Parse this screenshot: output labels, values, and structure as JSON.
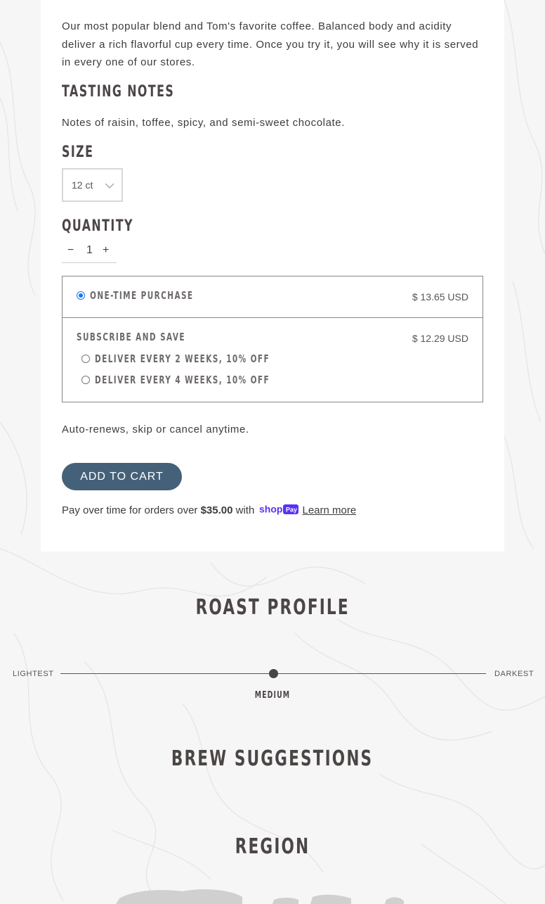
{
  "product": {
    "description": "Our most popular blend and Tom's favorite coffee. Balanced body and acidity deliver a rich flavorful cup every time. Once you try it, you will see why it is served in every one of our stores.",
    "tasting_notes_heading": "TASTING NOTES",
    "tasting_notes": "Notes of raisin, toffee, spicy, and semi-sweet chocolate.",
    "size_heading": "SIZE",
    "size_value": "12 ct",
    "quantity_heading": "QUANTITY",
    "quantity": {
      "minus": "−",
      "value": "1",
      "plus": "+"
    },
    "purchase": {
      "one_time_label": "ONE-TIME PURCHASE",
      "one_time_price": "$ 13.65 USD",
      "subscribe_label": "SUBSCRIBE AND SAVE",
      "subscribe_price": "$ 12.29 USD",
      "options": [
        "DELIVER EVERY 2 WEEKS, 10% OFF",
        "DELIVER EVERY 4 WEEKS, 10% OFF"
      ]
    },
    "autorenew": "Auto-renews, skip or cancel anytime.",
    "add_to_cart": "ADD TO CART",
    "pay": {
      "prefix": "Pay over time for orders over ",
      "amount": "$35.00",
      "with": " with ",
      "brand_shop": "shop",
      "brand_pay": "Pay",
      "learn_more": "Learn more"
    }
  },
  "roast": {
    "title": "ROAST PROFILE",
    "lightest": "LIGHTEST",
    "darkest": "DARKEST",
    "level_label": "MEDIUM",
    "level": 0.5
  },
  "brew": {
    "title": "BREW SUGGESTIONS"
  },
  "region": {
    "title": "REGION"
  },
  "colors": {
    "button": "#456179",
    "heading": "#4c4545",
    "shoppay": "#5a31f4",
    "radio_checked": "#1a73e8"
  }
}
